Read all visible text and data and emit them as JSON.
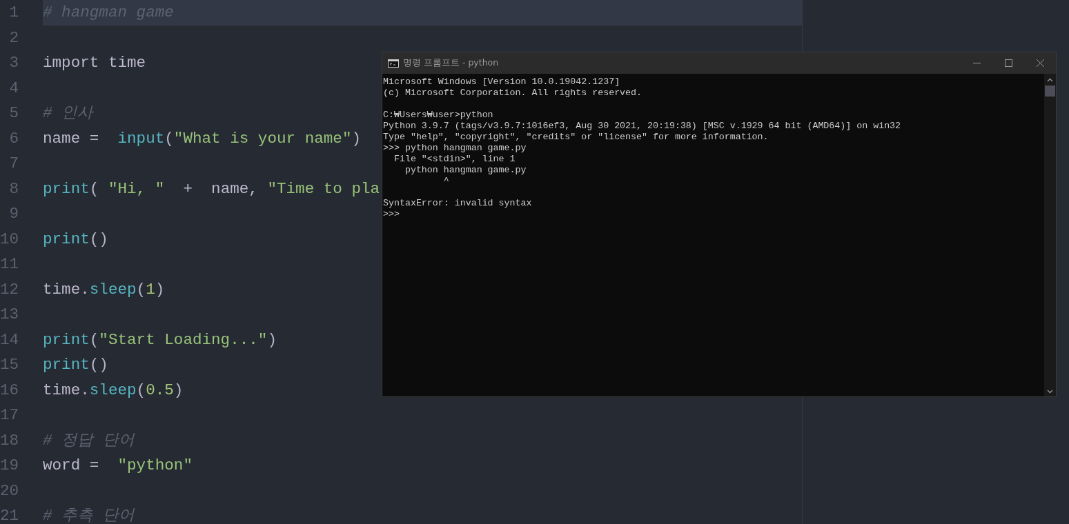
{
  "editor": {
    "lines": [
      {
        "number": "1",
        "current": true,
        "tokens": [
          {
            "kind": "comment",
            "text": "# hangman game"
          }
        ]
      },
      {
        "number": "2",
        "current": false
      },
      {
        "number": "3",
        "current": false,
        "tokens": [
          {
            "kind": "plain",
            "text": "import time"
          }
        ]
      },
      {
        "number": "4",
        "current": false
      },
      {
        "number": "5",
        "current": false,
        "tokens": [
          {
            "kind": "comment",
            "text": "# 인사"
          }
        ]
      },
      {
        "number": "6",
        "current": false,
        "tokens": [
          {
            "kind": "plain",
            "text": "name =  "
          },
          {
            "kind": "func",
            "text": "input"
          },
          {
            "kind": "paren",
            "text": "("
          },
          {
            "kind": "string",
            "text": "\"What is your name\""
          },
          {
            "kind": "paren",
            "text": ")"
          }
        ]
      },
      {
        "number": "7",
        "current": false
      },
      {
        "number": "8",
        "current": false,
        "tokens": [
          {
            "kind": "func",
            "text": "print"
          },
          {
            "kind": "paren",
            "text": "( "
          },
          {
            "kind": "string",
            "text": "\"Hi, \""
          },
          {
            "kind": "plain",
            "text": "  +  name, "
          },
          {
            "kind": "string",
            "text": "\"Time to pla"
          }
        ]
      },
      {
        "number": "9",
        "current": false
      },
      {
        "number": "10",
        "current": false,
        "tokens": [
          {
            "kind": "func",
            "text": "print"
          },
          {
            "kind": "paren",
            "text": "()"
          }
        ]
      },
      {
        "number": "11",
        "current": false
      },
      {
        "number": "12",
        "current": false,
        "tokens": [
          {
            "kind": "plain",
            "text": "time."
          },
          {
            "kind": "func",
            "text": "sleep"
          },
          {
            "kind": "paren",
            "text": "("
          },
          {
            "kind": "number",
            "text": "1"
          },
          {
            "kind": "paren",
            "text": ")"
          }
        ]
      },
      {
        "number": "13",
        "current": false
      },
      {
        "number": "14",
        "current": false,
        "tokens": [
          {
            "kind": "func",
            "text": "print"
          },
          {
            "kind": "paren",
            "text": "("
          },
          {
            "kind": "string",
            "text": "\"Start Loading...\""
          },
          {
            "kind": "paren",
            "text": ")"
          }
        ]
      },
      {
        "number": "15",
        "current": false,
        "tokens": [
          {
            "kind": "func",
            "text": "print"
          },
          {
            "kind": "paren",
            "text": "()"
          }
        ]
      },
      {
        "number": "16",
        "current": false,
        "tokens": [
          {
            "kind": "plain",
            "text": "time."
          },
          {
            "kind": "func",
            "text": "sleep"
          },
          {
            "kind": "paren",
            "text": "("
          },
          {
            "kind": "number",
            "text": "0.5"
          },
          {
            "kind": "paren",
            "text": ")"
          }
        ]
      },
      {
        "number": "17",
        "current": false
      },
      {
        "number": "18",
        "current": false,
        "tokens": [
          {
            "kind": "comment",
            "text": "# 정답 단어"
          }
        ]
      },
      {
        "number": "19",
        "current": false,
        "tokens": [
          {
            "kind": "plain",
            "text": "word =  "
          },
          {
            "kind": "string",
            "text": "\"python\""
          }
        ]
      },
      {
        "number": "20",
        "current": false
      },
      {
        "number": "21",
        "current": false,
        "tokens": [
          {
            "kind": "comment",
            "text": "# 추측 단어"
          }
        ]
      }
    ]
  },
  "console": {
    "title": "명령 프롬프트 - python",
    "blocks": [
      [
        "Microsoft Windows [Version 10.0.19042.1237]",
        "(c) Microsoft Corporation. All rights reserved."
      ],
      [
        "C:₩Users₩user>python",
        "Python 3.9.7 (tags/v3.9.7:1016ef3, Aug 30 2021, 20:19:38) [MSC v.1929 64 bit (AMD64)] on win32",
        "Type \"help\", \"copyright\", \"credits\" or \"license\" for more information.",
        ">>> python hangman game.py",
        "  File \"<stdin>\", line 1",
        "    python hangman game.py",
        "           ^"
      ],
      [
        "SyntaxError: invalid syntax",
        ">>>"
      ]
    ]
  }
}
